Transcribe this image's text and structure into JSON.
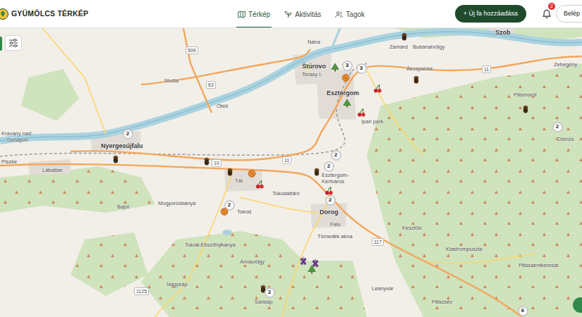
{
  "app": {
    "title": "GYÜMÖLCS TÉRKÉP"
  },
  "tabs": [
    {
      "label": "Térkép",
      "selected": true
    },
    {
      "label": "Aktivitás",
      "selected": false
    },
    {
      "label": "Tagok",
      "selected": false
    }
  ],
  "add_button": {
    "label": "+ Új fa hozzáadása"
  },
  "notifications": {
    "count": "2"
  },
  "login_button": {
    "label": "Belép"
  },
  "map": {
    "places": [
      {
        "name": "Szob",
        "kind": "town"
      },
      {
        "name": "Zamárd",
        "kind": "village"
      },
      {
        "name": "Bubánatvölgy",
        "kind": "village"
      },
      {
        "name": "Zebegény",
        "kind": "village"
      },
      {
        "name": "Nána",
        "kind": "village"
      },
      {
        "name": "Štúrovo",
        "kind": "town"
      },
      {
        "name": "Terasy I.",
        "kind": "village"
      },
      {
        "name": "Ákospalota",
        "kind": "village"
      },
      {
        "name": "Esztergom",
        "kind": "town"
      },
      {
        "name": "Ipari park",
        "kind": "village"
      },
      {
        "name": "Pilismarót",
        "kind": "village"
      },
      {
        "name": "Dömös",
        "kind": "village"
      },
      {
        "name": "Mužla",
        "kind": "village"
      },
      {
        "name": "Obid",
        "kind": "village"
      },
      {
        "name": "Kravany nad",
        "kind": "village"
      },
      {
        "name": "Dunajom",
        "kind": "village"
      },
      {
        "name": "Nyergesújfalu",
        "kind": "town"
      },
      {
        "name": "Piszke",
        "kind": "village"
      },
      {
        "name": "Lábatlan",
        "kind": "village"
      },
      {
        "name": "Tát",
        "kind": "village"
      },
      {
        "name": "Tokodaltáró",
        "kind": "village"
      },
      {
        "name": "Mogyorósbánya",
        "kind": "village"
      },
      {
        "name": "Bajót",
        "kind": "village"
      },
      {
        "name": "Tokod",
        "kind": "village"
      },
      {
        "name": "Esztergom-",
        "kind": "village"
      },
      {
        "name": "Kertváros",
        "kind": "village"
      },
      {
        "name": "Dorog",
        "kind": "town"
      },
      {
        "name": "Falu",
        "kind": "village"
      },
      {
        "name": "Tömedék akna",
        "kind": "village"
      },
      {
        "name": "Kesztölc",
        "kind": "village"
      },
      {
        "name": "Klastrompuszta",
        "kind": "village"
      },
      {
        "name": "Tokod-Ebszőnybánya",
        "kind": "village"
      },
      {
        "name": "Annavölgy",
        "kind": "village"
      },
      {
        "name": "Nagysáp",
        "kind": "village"
      },
      {
        "name": "Sárisáp",
        "kind": "village"
      },
      {
        "name": "Leányvár",
        "kind": "village"
      },
      {
        "name": "Piliscsév",
        "kind": "village"
      },
      {
        "name": "Pilisszentkereszt",
        "kind": "village"
      }
    ],
    "roads": [
      {
        "number": "509"
      },
      {
        "number": "63"
      },
      {
        "number": "10"
      },
      {
        "number": "11"
      },
      {
        "number": "11"
      },
      {
        "number": "117"
      },
      {
        "number": "1125"
      }
    ],
    "pins": [
      {
        "kind": "cluster",
        "count": "2"
      },
      {
        "kind": "nut"
      },
      {
        "kind": "nut"
      },
      {
        "kind": "nut"
      },
      {
        "kind": "apricot"
      },
      {
        "kind": "cherry"
      },
      {
        "kind": "cluster",
        "count": "2"
      },
      {
        "kind": "apricot"
      },
      {
        "kind": "nut"
      },
      {
        "kind": "tree"
      },
      {
        "kind": "cluster",
        "count": "3"
      },
      {
        "kind": "cluster",
        "count": "3"
      },
      {
        "kind": "apricot"
      },
      {
        "kind": "tree"
      },
      {
        "kind": "cherry"
      },
      {
        "kind": "cherry"
      },
      {
        "kind": "nut"
      },
      {
        "kind": "nut"
      },
      {
        "kind": "cluster",
        "count": "2"
      },
      {
        "kind": "cluster",
        "count": "2"
      },
      {
        "kind": "cluster",
        "count": "2"
      },
      {
        "kind": "nut"
      },
      {
        "kind": "cherry"
      },
      {
        "kind": "cluster",
        "count": "2"
      },
      {
        "kind": "plum"
      },
      {
        "kind": "plum"
      },
      {
        "kind": "tree"
      },
      {
        "kind": "nut"
      },
      {
        "kind": "cluster",
        "count": "2"
      },
      {
        "kind": "cluster",
        "count": "6"
      }
    ]
  }
}
